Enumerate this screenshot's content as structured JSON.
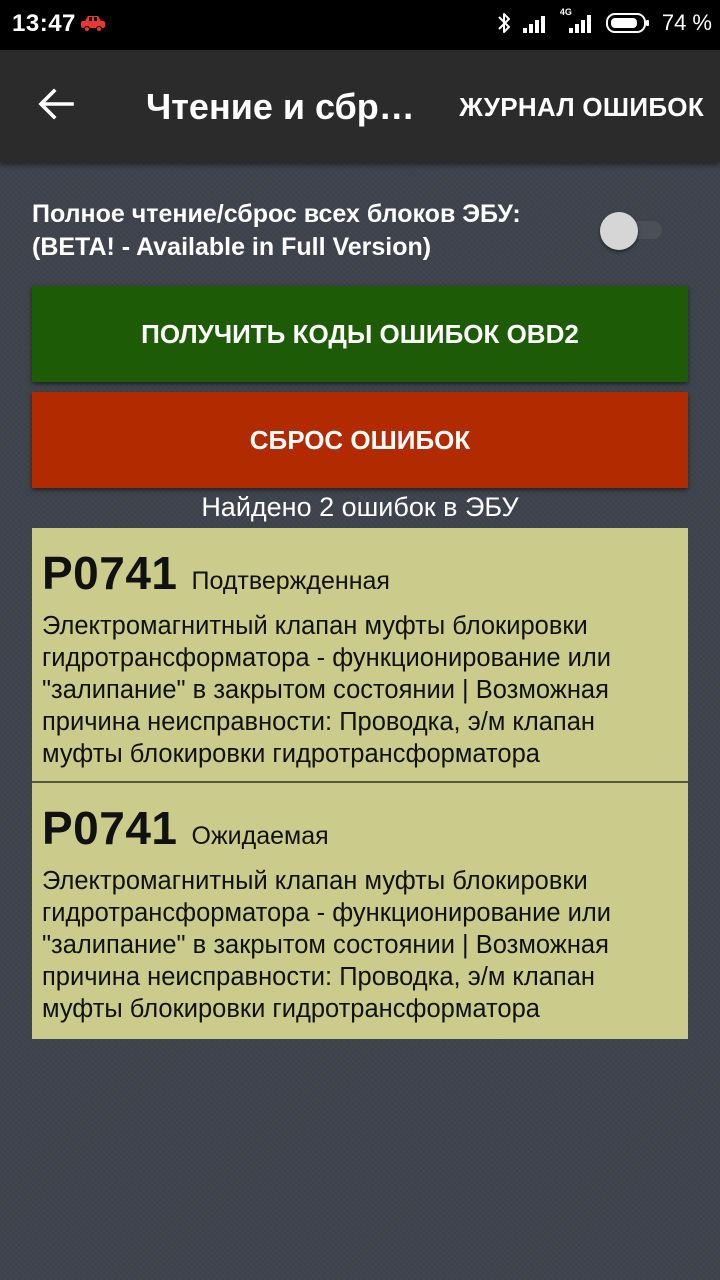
{
  "status_bar": {
    "time": "13:47",
    "notification_icon": "car-icon",
    "battery_percent": "74 %",
    "network_label": "4G"
  },
  "toolbar": {
    "title": "Чтение и сброс ошибок",
    "action_label": "ЖУРНАЛ ОШИБОК"
  },
  "full_read": {
    "label_line1": "Полное чтение/сброс всех блоков ЭБУ:",
    "label_line2": "(BETA! - Available in Full Version)",
    "enabled": false
  },
  "buttons": {
    "read_label": "ПОЛУЧИТЬ КОДЫ ОШИБОК OBD2",
    "reset_label": "СБРОС ОШИБОК"
  },
  "found_text": "Найдено 2 ошибок в ЭБУ",
  "errors": [
    {
      "code": "P0741",
      "status": "Подтвержденная",
      "description": "Электромагнитный клапан муфты блокировки гидротрансформатора - функционирование или \"залипание\" в закрытом состоянии | Возможная причина неисправности: Проводка, э/м клапан муфты блокировки гидротрансформатора"
    },
    {
      "code": "P0741",
      "status": "Ожидаемая",
      "description": "Электромагнитный клапан муфты блокировки гидротрансформатора - функционирование или \"залипание\" в закрытом состоянии | Возможная причина неисправности: Проводка, э/м клапан муфты блокировки гидротрансформатора"
    }
  ],
  "colors": {
    "read_button": "#1e5b06",
    "reset_button": "#b22a00",
    "card_background": "#cbcc8b",
    "toolbar": "#2b2b2b"
  }
}
